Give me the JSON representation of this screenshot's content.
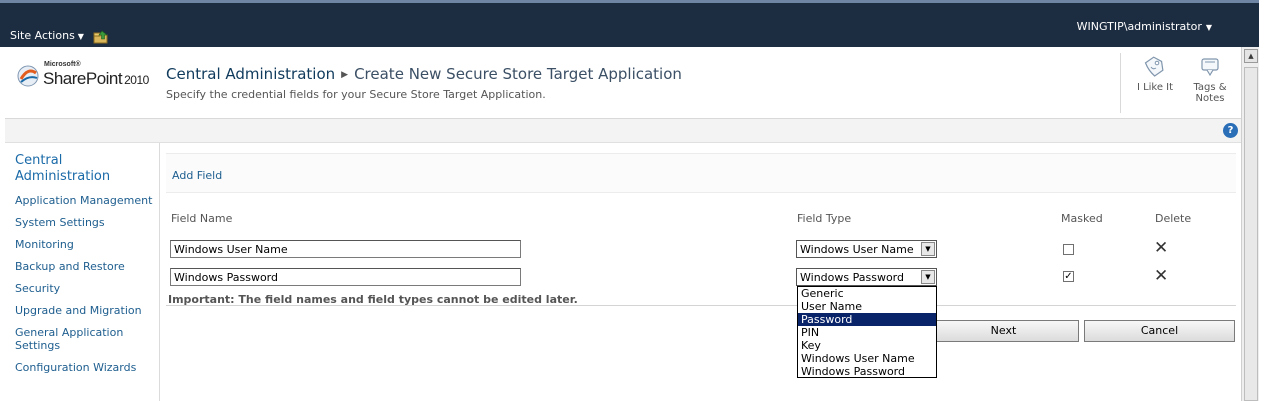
{
  "topbar": {
    "site_actions": "Site Actions",
    "user": "WINGTIP\\administrator"
  },
  "header": {
    "logo_microsoft": "Microsoft®",
    "logo_product": "SharePoint",
    "logo_year": "2010",
    "breadcrumb_root": "Central Administration",
    "breadcrumb_current": "Create New Secure Store Target Application",
    "description": "Specify the credential fields for your Secure Store Target Application.",
    "like_label": "I Like It",
    "tags_label_1": "Tags &",
    "tags_label_2": "Notes",
    "help_symbol": "?"
  },
  "leftnav": {
    "title": "Central Administration",
    "items": [
      {
        "label": "Application Management"
      },
      {
        "label": "System Settings"
      },
      {
        "label": "Monitoring"
      },
      {
        "label": "Backup and Restore"
      },
      {
        "label": "Security"
      },
      {
        "label": "Upgrade and Migration"
      },
      {
        "label": "General Application Settings"
      },
      {
        "label": "Configuration Wizards"
      }
    ]
  },
  "main": {
    "add_field": "Add Field",
    "columns": {
      "field_name": "Field Name",
      "field_type": "Field Type",
      "masked": "Masked",
      "delete": "Delete"
    },
    "rows": [
      {
        "name": "Windows User Name",
        "type": "Windows User Name",
        "masked": false
      },
      {
        "name": "Windows Password",
        "type": "Windows Password",
        "masked": true
      }
    ],
    "important": "Important: The field names and field types cannot be edited later.",
    "next_label": "Next",
    "cancel_label": "Cancel",
    "dropdown_options": [
      {
        "label": "Generic",
        "selected": false
      },
      {
        "label": "User Name",
        "selected": false
      },
      {
        "label": "Password",
        "selected": true
      },
      {
        "label": "PIN",
        "selected": false
      },
      {
        "label": "Key",
        "selected": false
      },
      {
        "label": "Windows User Name",
        "selected": false
      },
      {
        "label": "Windows Password",
        "selected": false
      }
    ]
  },
  "glyphs": {
    "caret": "▼",
    "sep": "▶",
    "check": "✓",
    "delete": "✕"
  },
  "colors": {
    "ribbon_bg": "#1d2d41",
    "link": "#1e5e8f",
    "selection": "#0a246a"
  }
}
